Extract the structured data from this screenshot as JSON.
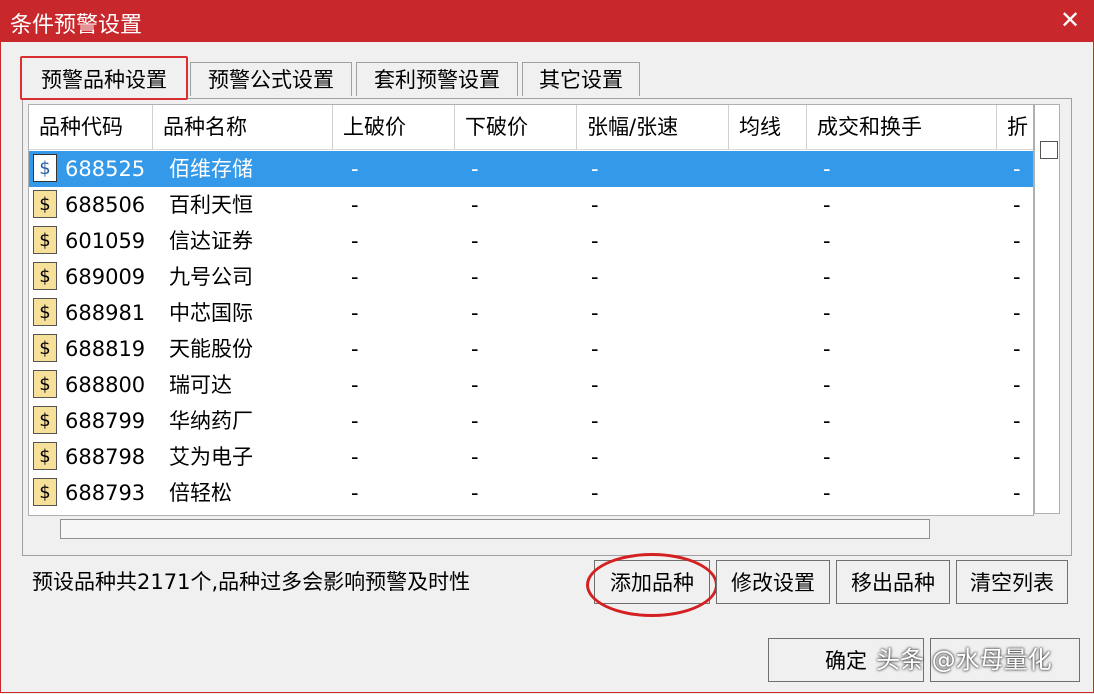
{
  "window": {
    "title": "条件预警设置",
    "close_glyph": "✕"
  },
  "tabs": [
    {
      "label": "预警品种设置",
      "active": true
    },
    {
      "label": "预警公式设置",
      "active": false
    },
    {
      "label": "套利预警设置",
      "active": false
    },
    {
      "label": "其它设置",
      "active": false
    }
  ],
  "table": {
    "columns": [
      "品种代码",
      "品种名称",
      "上破价",
      "下破价",
      "张幅/张速",
      "均线",
      "成交和换手",
      "折"
    ],
    "rows": [
      {
        "code": "688525",
        "name": "佰维存储",
        "values": [
          "-",
          "-",
          "-",
          "-",
          "-"
        ],
        "selected": true
      },
      {
        "code": "688506",
        "name": "百利天恒",
        "values": [
          "-",
          "-",
          "-",
          "-",
          "-"
        ]
      },
      {
        "code": "601059",
        "name": "信达证券",
        "values": [
          "-",
          "-",
          "-",
          "-",
          "-"
        ]
      },
      {
        "code": "689009",
        "name": "九号公司",
        "values": [
          "-",
          "-",
          "-",
          "-",
          "-"
        ]
      },
      {
        "code": "688981",
        "name": "中芯国际",
        "values": [
          "-",
          "-",
          "-",
          "-",
          "-"
        ]
      },
      {
        "code": "688819",
        "name": "天能股份",
        "values": [
          "-",
          "-",
          "-",
          "-",
          "-"
        ]
      },
      {
        "code": "688800",
        "name": "瑞可达",
        "values": [
          "-",
          "-",
          "-",
          "-",
          "-"
        ]
      },
      {
        "code": "688799",
        "name": "华纳药厂",
        "values": [
          "-",
          "-",
          "-",
          "-",
          "-"
        ]
      },
      {
        "code": "688798",
        "name": "艾为电子",
        "values": [
          "-",
          "-",
          "-",
          "-",
          "-"
        ]
      },
      {
        "code": "688793",
        "name": "倍轻松",
        "values": [
          "-",
          "-",
          "-",
          "-",
          "-"
        ]
      }
    ],
    "icon": "dollar-icon",
    "icon_glyph": "$"
  },
  "status_text": "预设品种共2171个,品种过多会影响预警及时性",
  "buttons": {
    "add": "添加品种",
    "modify": "修改设置",
    "remove": "移出品种",
    "clear": "清空列表",
    "ok": "确定"
  },
  "watermark": "头条 @水母量化",
  "colors": {
    "titlebar": "#c8282c",
    "selection": "#3399e8",
    "annotation": "#d42020",
    "icon_bg": "#f7e19a"
  }
}
